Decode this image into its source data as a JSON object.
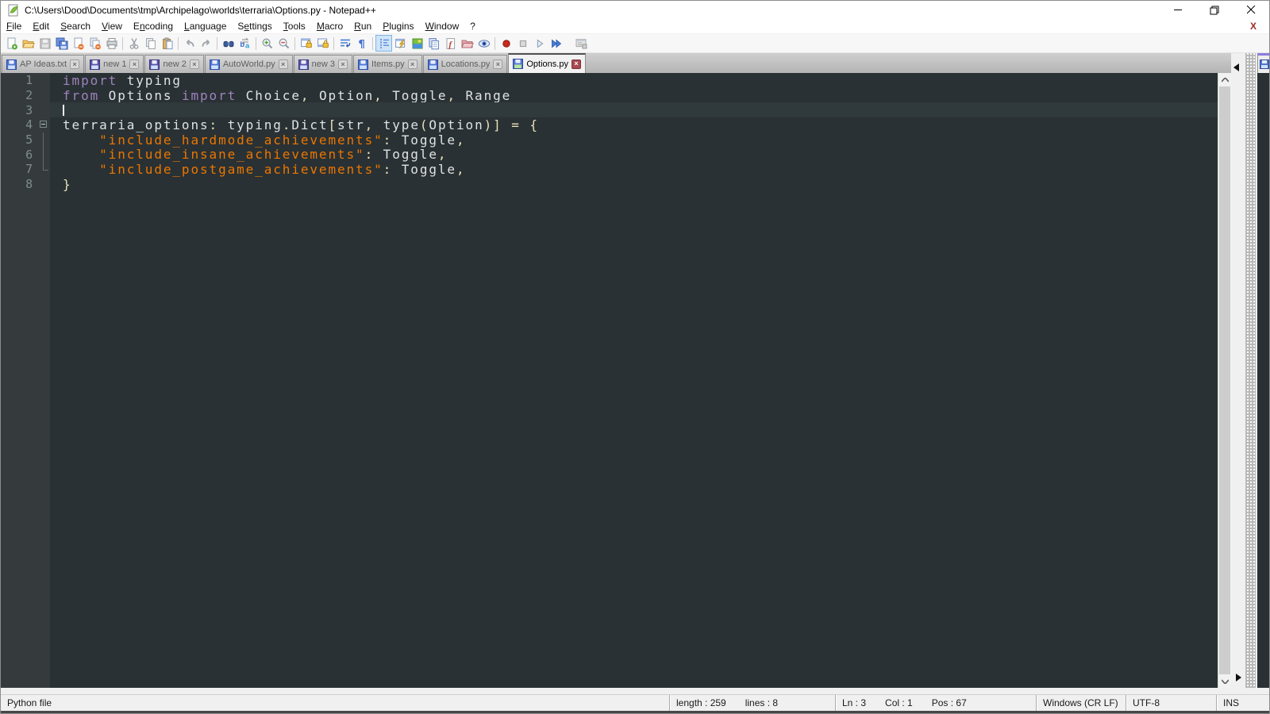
{
  "window": {
    "title": "C:\\Users\\Dood\\Documents\\tmp\\Archipelago\\worlds\\terraria\\Options.py - Notepad++"
  },
  "menu": {
    "items": [
      {
        "label": "File",
        "u": 0
      },
      {
        "label": "Edit",
        "u": 0
      },
      {
        "label": "Search",
        "u": 0
      },
      {
        "label": "View",
        "u": 0
      },
      {
        "label": "Encoding",
        "u": 1
      },
      {
        "label": "Language",
        "u": 0
      },
      {
        "label": "Settings",
        "u": 1
      },
      {
        "label": "Tools",
        "u": 0
      },
      {
        "label": "Macro",
        "u": 0
      },
      {
        "label": "Run",
        "u": 0
      },
      {
        "label": "Plugins",
        "u": 0
      },
      {
        "label": "Window",
        "u": 0
      },
      {
        "label": "?",
        "u": -1
      }
    ],
    "doc_close_label": "X"
  },
  "toolbar": {
    "groups": [
      [
        "new-document",
        "open-folder",
        "save",
        "save-all",
        "close-document",
        "close-all-documents",
        "print"
      ],
      [
        "cut",
        "copy",
        "paste"
      ],
      [
        "undo",
        "redo"
      ],
      [
        "find",
        "replace"
      ],
      [
        "zoom-in",
        "zoom-out"
      ],
      [
        "sync-vertical-scroll",
        "sync-horizontal-scroll"
      ],
      [
        "word-wrap",
        "show-all-characters"
      ],
      [
        "indent-guide",
        "function-completion",
        "document-map",
        "document-list",
        "function-list",
        "folder-as-workspace",
        "monitoring"
      ],
      [
        "macro-record",
        "macro-stop",
        "macro-play",
        "macro-run-multiple"
      ],
      [
        "macro-save"
      ]
    ],
    "pressed": [
      "indent-guide"
    ]
  },
  "tabs": [
    {
      "label": "AP Ideas.txt",
      "state": "saved",
      "active": false
    },
    {
      "label": "new 1",
      "state": "modified",
      "active": false
    },
    {
      "label": "new 2",
      "state": "modified",
      "active": false
    },
    {
      "label": "AutoWorld.py",
      "state": "saved",
      "active": false
    },
    {
      "label": "new 3",
      "state": "modified",
      "active": false
    },
    {
      "label": "Items.py",
      "state": "saved",
      "active": false
    },
    {
      "label": "Locations.py",
      "state": "saved",
      "active": false
    },
    {
      "label": "Options.py",
      "state": "saved",
      "active": true
    }
  ],
  "editor": {
    "cursor_line": 3,
    "lines": [
      {
        "n": "1",
        "fold": "",
        "tokens": [
          [
            "kw",
            "import"
          ],
          [
            "def",
            " typing"
          ]
        ]
      },
      {
        "n": "2",
        "fold": "",
        "tokens": [
          [
            "kw",
            "from"
          ],
          [
            "def",
            " Options "
          ],
          [
            "kw",
            "import"
          ],
          [
            "def",
            " Choice"
          ],
          [
            "op",
            ","
          ],
          [
            "def",
            " Option"
          ],
          [
            "op",
            ","
          ],
          [
            "def",
            " Toggle"
          ],
          [
            "op",
            ","
          ],
          [
            "def",
            " Range"
          ]
        ]
      },
      {
        "n": "3",
        "fold": "",
        "tokens": []
      },
      {
        "n": "4",
        "fold": "box",
        "tokens": [
          [
            "def",
            "terraria_options"
          ],
          [
            "op",
            ":"
          ],
          [
            "def",
            " typing"
          ],
          [
            "op",
            "."
          ],
          [
            "def",
            "Dict"
          ],
          [
            "op",
            "["
          ],
          [
            "def",
            "str"
          ],
          [
            "op",
            ","
          ],
          [
            "def",
            " type"
          ],
          [
            "op",
            "("
          ],
          [
            "def",
            "Option"
          ],
          [
            "op",
            ")"
          ],
          [
            "op",
            "]"
          ],
          [
            "def",
            " "
          ],
          [
            "op",
            "="
          ],
          [
            "def",
            " "
          ],
          [
            "op",
            "{"
          ]
        ]
      },
      {
        "n": "5",
        "fold": "line",
        "tokens": [
          [
            "def",
            "    "
          ],
          [
            "str",
            "\"include_hardmode_achievements\""
          ],
          [
            "op",
            ":"
          ],
          [
            "def",
            " Toggle"
          ],
          [
            "op",
            ","
          ]
        ]
      },
      {
        "n": "6",
        "fold": "line",
        "tokens": [
          [
            "def",
            "    "
          ],
          [
            "str",
            "\"include_insane_achievements\""
          ],
          [
            "op",
            ":"
          ],
          [
            "def",
            " Toggle"
          ],
          [
            "op",
            ","
          ]
        ]
      },
      {
        "n": "7",
        "fold": "corner",
        "tokens": [
          [
            "def",
            "    "
          ],
          [
            "str",
            "\"include_postgame_achievements\""
          ],
          [
            "op",
            ":"
          ],
          [
            "def",
            " Toggle"
          ],
          [
            "op",
            ","
          ]
        ]
      },
      {
        "n": "8",
        "fold": "",
        "tokens": [
          [
            "op",
            "}"
          ]
        ]
      }
    ]
  },
  "status": {
    "doc_type": "Python file",
    "length": "length : 259",
    "lines": "lines : 8",
    "ln": "Ln : 3",
    "col": "Col : 1",
    "pos": "Pos : 67",
    "eol": "Windows (CR LF)",
    "encoding": "UTF-8",
    "mode": "INS"
  },
  "colors": {
    "editor_bg": "#293134",
    "keyword": "#a082bd",
    "string": "#ec7600",
    "operator": "#e8e2b7",
    "default_text": "#e0e2e4"
  }
}
